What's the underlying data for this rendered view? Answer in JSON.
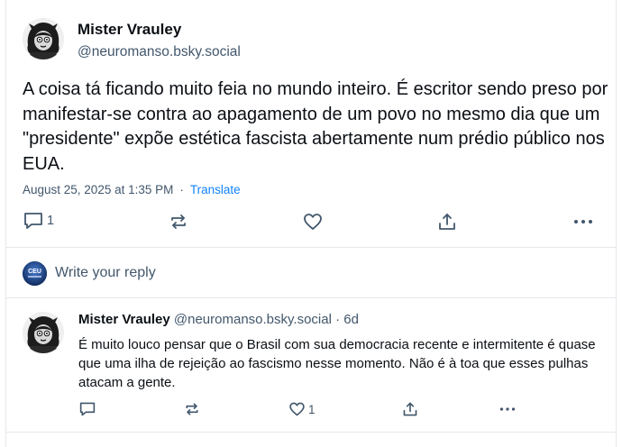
{
  "post": {
    "author_name": "Mister Vrauley",
    "author_handle": "@neuromanso.bsky.social",
    "text": "A coisa tá ficando muito feia no mundo inteiro. É escritor sendo preso por manifestar-se contra ao apagamento de um povo no mesmo dia que um \"presidente\" expõe estética fascista abertamente num prédio público nos EUA.",
    "timestamp": "August 25, 2025 at 1:35 PM",
    "separator": "·",
    "translate_label": "Translate",
    "reply_count": "1",
    "repost_count": "",
    "like_count": ""
  },
  "composer": {
    "placeholder": "Write your reply",
    "avatar_label": "CEU"
  },
  "reply": {
    "author_name": "Mister Vrauley",
    "author_handle": "@neuromanso.bsky.social",
    "separator": "·",
    "time_ago": "6d",
    "text": "É muito louco pensar que o Brasil com sua democracia recente e intermitente é quase que uma ilha de rejeição ao fascismo nesse momento. Não é à toa que esses pulhas atacam a gente.",
    "reply_count": "",
    "repost_count": "",
    "like_count": "1"
  },
  "icons": {
    "reply": "reply-bubble-icon",
    "repost": "repost-arrows-icon",
    "like": "heart-icon",
    "share": "share-arrow-icon",
    "more": "ellipsis-icon"
  },
  "colors": {
    "text_primary": "#0b0f14",
    "text_secondary": "#42576c",
    "link": "#1083fe",
    "divider": "#e4e8ec"
  }
}
